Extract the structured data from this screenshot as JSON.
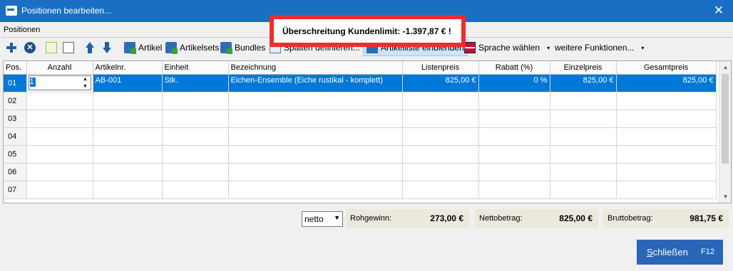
{
  "window": {
    "title": "Positionen bearbeiten...",
    "close_glyph": "✕"
  },
  "section_label": "Positionen",
  "alert": {
    "text": "Überschreitung Kundenlimit: -1.397,87 € !",
    "border_color": "#ee2d2d"
  },
  "toolbar": {
    "artikel": "Artikel",
    "artikelsets": "Artikelsets",
    "bundles": "Bundles",
    "spalten": "Spalten definieren...",
    "artikelliste": "Artikelliste einblenden",
    "sprache": "Sprache wählen",
    "weitere": "weitere Funktionen...",
    "caret": "▾"
  },
  "grid": {
    "columns": [
      "Pos.",
      "Anzahl",
      "Artikelnr.",
      "Einheit",
      "Bezeichnung",
      "Listenpreis",
      "Rabatt (%)",
      "Einzelpreis",
      "Gesamtpreis"
    ],
    "selected_row": {
      "pos": "01",
      "anzahl": "1",
      "artikelnr": "AB-001",
      "einheit": "Stk.",
      "bezeichnung": "Eichen-Ensemble (Eiche rustikal - komplett)",
      "listenpreis": "825,00 €",
      "rabatt": "0 %",
      "einzelpreis": "825,00 €",
      "gesamtpreis": "825,00 €"
    },
    "empty_rows": [
      "02",
      "03",
      "04",
      "05",
      "06",
      "07"
    ],
    "selection_color": "#0078d7"
  },
  "footer": {
    "mode": "netto",
    "rohgewinn_label": "Rohgewinn:",
    "rohgewinn_value": "273,00 €",
    "netto_label": "Nettobetrag:",
    "netto_value": "825,00 €",
    "brutto_label": "Bruttobetrag:",
    "brutto_value": "981,75 €"
  },
  "close_button": {
    "label_prefix": "S",
    "label_rest": "chließen",
    "shortcut": "F12",
    "color": "#2b65b8"
  }
}
